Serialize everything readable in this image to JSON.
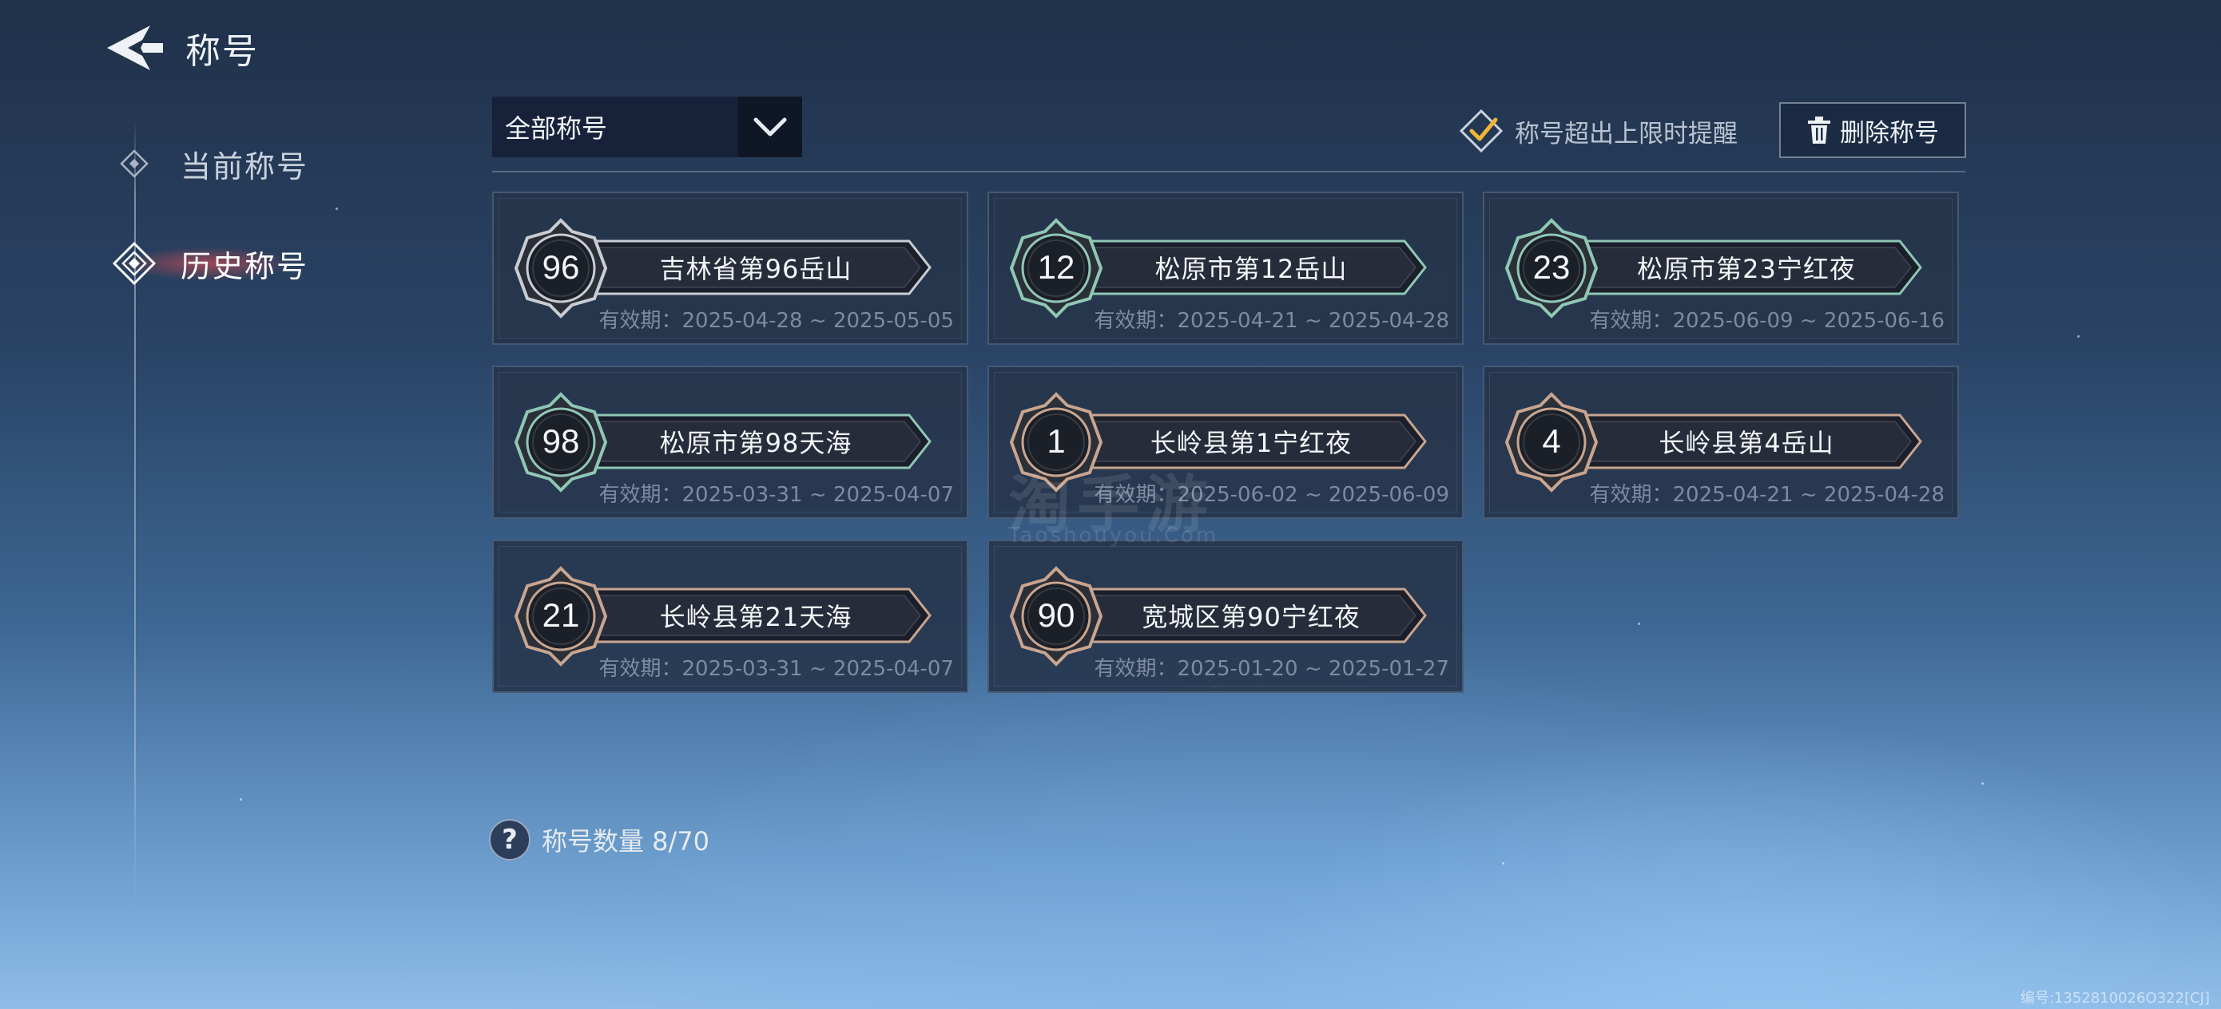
{
  "header": {
    "title": "称号",
    "back_icon": "back-arrow-icon"
  },
  "sidebar": {
    "items": [
      {
        "label": "当前称号",
        "active": false
      },
      {
        "label": "历史称号",
        "active": true
      }
    ]
  },
  "toolbar": {
    "filter_value": "全部称号",
    "reminder_label": "称号超出上限时提醒",
    "reminder_checked": true,
    "delete_label": "删除称号"
  },
  "titles": [
    {
      "rank": "96",
      "name": "吉林省第96岳山",
      "validity": "有效期：2025-04-28 ~ 2025-05-05",
      "frame": "silver"
    },
    {
      "rank": "12",
      "name": "松原市第12岳山",
      "validity": "有效期：2025-04-21 ~ 2025-04-28",
      "frame": "jade"
    },
    {
      "rank": "23",
      "name": "松原市第23宁红夜",
      "validity": "有效期：2025-06-09 ~ 2025-06-16",
      "frame": "jade"
    },
    {
      "rank": "98",
      "name": "松原市第98天海",
      "validity": "有效期：2025-03-31 ~ 2025-04-07",
      "frame": "jade"
    },
    {
      "rank": "1",
      "name": "长岭县第1宁红夜",
      "validity": "有效期：2025-06-02 ~ 2025-06-09",
      "frame": "bronze"
    },
    {
      "rank": "4",
      "name": "长岭县第4岳山",
      "validity": "有效期：2025-04-21 ~ 2025-04-28",
      "frame": "bronze"
    },
    {
      "rank": "21",
      "name": "长岭县第21天海",
      "validity": "有效期：2025-03-31 ~ 2025-04-07",
      "frame": "bronze"
    },
    {
      "rank": "90",
      "name": "宽城区第90宁红夜",
      "validity": "有效期：2025-01-20 ~ 2025-01-27",
      "frame": "bronze"
    }
  ],
  "footer": {
    "count_label": "称号数量 8/70",
    "help_icon": "question-icon"
  },
  "watermark": {
    "text": "淘手游",
    "sub": "Taoshouyou.Com"
  },
  "serial": "编号:1352810026O322[CJ]",
  "colors": {
    "silver": "#c9ccd2",
    "jade": "#8fc7b4",
    "bronze": "#c9a58f"
  }
}
